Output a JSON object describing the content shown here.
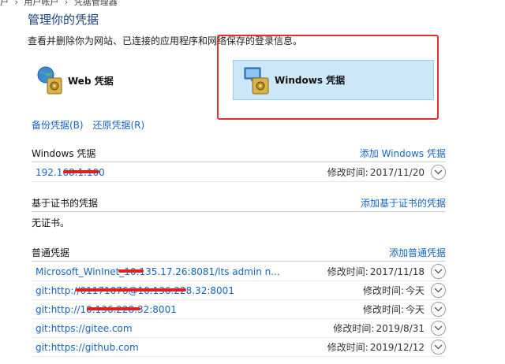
{
  "breadcrumb": [
    "户",
    "用户帐户",
    "凭据管理器"
  ],
  "page": {
    "title": "管理你的凭据",
    "description": "查看并删除你为网站、已连接的应用程序和网络保存的登录信息。"
  },
  "cred_types": {
    "web": {
      "label": "Web 凭据",
      "icon": "web-credentials-icon"
    },
    "windows": {
      "label": "Windows 凭据",
      "icon": "windows-credentials-icon",
      "selected": true
    }
  },
  "actions": {
    "backup": "备份凭据(B)",
    "restore": "还原凭据(R)"
  },
  "windows_section": {
    "title": "Windows 凭据",
    "add": "添加 Windows 凭据",
    "rows": [
      {
        "name": "192.168.1.100",
        "mod_label": "修改时间:",
        "mod_value": "2017/11/20"
      }
    ]
  },
  "cert_section": {
    "title": "基于证书的凭据",
    "add": "添加基于证书的凭据",
    "empty": "无证书。"
  },
  "generic_section": {
    "title": "普通凭据",
    "add": "添加普通凭据",
    "rows": [
      {
        "name": "Microsoft_WinInet_10.135.17.26:8081/lts admin n...",
        "mod_label": "修改时间:",
        "mod_value": "2017/11/18"
      },
      {
        "name": "git:http://01171076@10.136.228.32:8001",
        "mod_label": "修改时间:",
        "mod_value": "今天"
      },
      {
        "name": "git:http://10.136.228.32:8001",
        "mod_label": "修改时间:",
        "mod_value": "今天"
      },
      {
        "name": "git:https://gitee.com",
        "mod_label": "修改时间:",
        "mod_value": "2019/8/31"
      },
      {
        "name": "git:https://github.com",
        "mod_label": "修改时间:",
        "mod_value": "2019/12/12"
      }
    ]
  },
  "colors": {
    "link": "#1565c0",
    "highlight": "#e03131",
    "selected_bg": "#cce8f8",
    "title": "#1a3f7a"
  }
}
